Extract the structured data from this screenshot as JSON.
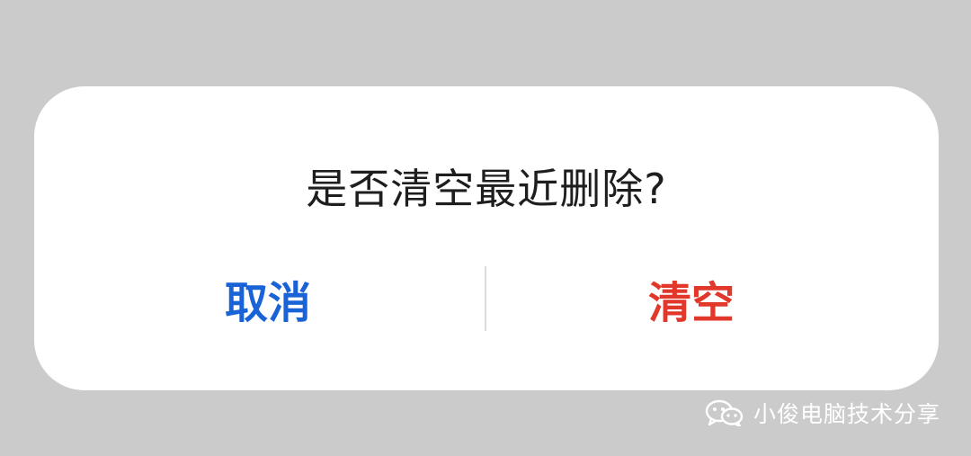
{
  "dialog": {
    "title": "是否清空最近删除?",
    "cancel_label": "取消",
    "confirm_label": "清空"
  },
  "watermark": {
    "icon": "wechat-icon",
    "text": "小俊电脑技术分享"
  },
  "colors": {
    "background_overlay": "#cbcbcb",
    "dialog_background": "#ffffff",
    "title": "#1e1e1e",
    "cancel": "#1a63d6",
    "confirm": "#e2372b",
    "divider": "#dcdcdc",
    "watermark": "#ffffff"
  }
}
